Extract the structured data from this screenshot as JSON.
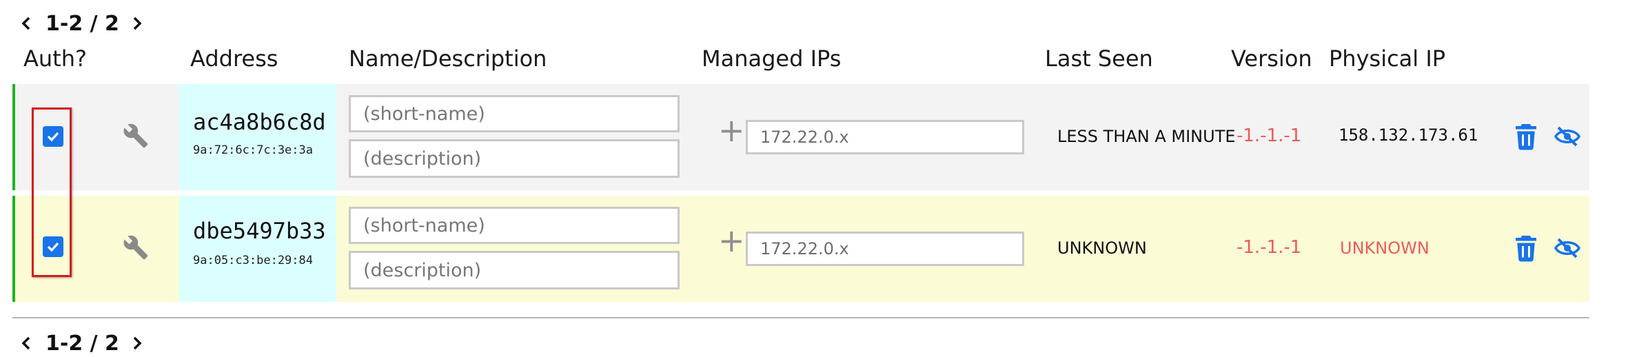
{
  "pager_top": {
    "label": "1-2 / 2"
  },
  "pager_bottom": {
    "label": "1-2 / 2"
  },
  "headers": {
    "auth": "Auth?",
    "address": "Address",
    "name": "Name/Description",
    "managed_ips": "Managed IPs",
    "last_seen": "Last Seen",
    "version": "Version",
    "physical_ip": "Physical IP"
  },
  "rows": [
    {
      "authorized": true,
      "address": "ac4a8b6c8d",
      "mac": "9a:72:6c:7c:3e:3a",
      "short_name_placeholder": "(short-name)",
      "description_placeholder": "(description)",
      "ip_placeholder": "172.22.0.x",
      "last_seen": "LESS THAN A MINUTE",
      "version": "-1.-1.-1",
      "physical_ip": "158.132.173.61",
      "physical_ip_color": "#111111"
    },
    {
      "authorized": true,
      "address": "dbe5497b33",
      "mac": "9a:05:c3:be:29:84",
      "short_name_placeholder": "(short-name)",
      "description_placeholder": "(description)",
      "ip_placeholder": "172.22.0.x",
      "last_seen": "UNKNOWN",
      "version": "-1.-1.-1",
      "physical_ip": "UNKNOWN",
      "physical_ip_color": "#ec5b5b"
    }
  ],
  "colors": {
    "accent_blue": "#1a73e8",
    "row1_bg": "#f3f3f4",
    "row2_bg": "#fbfbd6",
    "address_bg": "#dbffff",
    "online_bar": "#21b321",
    "warning_red": "#ec5b5b",
    "highlight_red": "#d31d1d"
  },
  "icons": {
    "prev": "chevron-left-icon",
    "next": "chevron-right-icon",
    "config": "wrench-icon",
    "add_ip": "plus-icon",
    "delete": "trash-icon",
    "hide": "eye-slash-icon"
  }
}
